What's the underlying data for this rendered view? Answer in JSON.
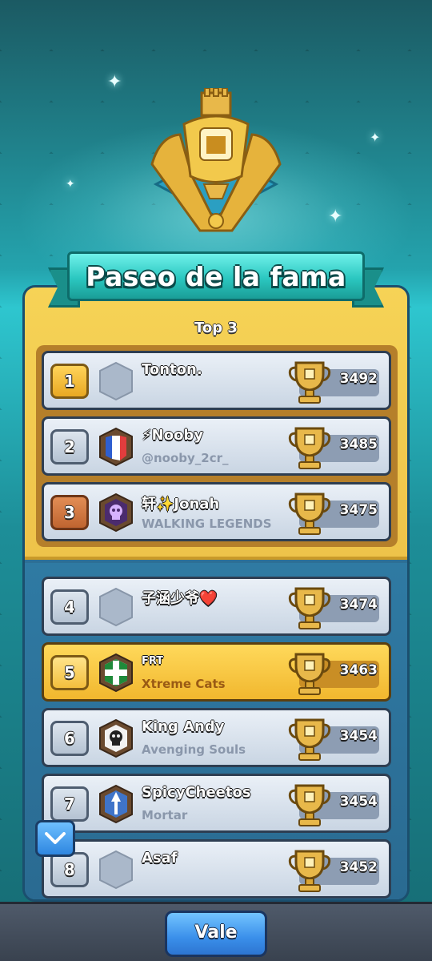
{
  "screen": {
    "title": "Paseo de la fama"
  },
  "top_section": {
    "label": "Top 3"
  },
  "players": [
    {
      "rank": "1",
      "name": "Tonton.",
      "clan": "",
      "trophies": "3492",
      "rank_style": "gold",
      "badge": "empty-badge"
    },
    {
      "rank": "2",
      "name": "⚡Nooby",
      "clan": "@nooby_2cr_",
      "trophies": "3485",
      "rank_style": "silver",
      "badge": "france-flag-badge"
    },
    {
      "rank": "3",
      "name": "轩✨Jonah",
      "clan": "WALKING LEGENDS",
      "trophies": "3475",
      "rank_style": "bronze",
      "badge": "skull-purple-badge"
    },
    {
      "rank": "4",
      "name": "子涵少爷❤️",
      "clan": "",
      "trophies": "3474",
      "rank_style": "silver",
      "badge": "empty-badge"
    },
    {
      "rank": "5",
      "name": "FRT",
      "clan": "Xtreme Cats",
      "trophies": "3463",
      "rank_style": "me",
      "badge": "green-cross-badge"
    },
    {
      "rank": "6",
      "name": "King Andy",
      "clan": "Avenging Souls",
      "trophies": "3454",
      "rank_style": "silver",
      "badge": "skull-badge"
    },
    {
      "rank": "7",
      "name": "SpicyCheetos",
      "clan": "Mortar",
      "trophies": "3454",
      "rank_style": "silver",
      "badge": "arrow-blue-badge"
    },
    {
      "rank": "8",
      "name": "Asaf",
      "clan": "",
      "trophies": "3452",
      "rank_style": "silver",
      "badge": "empty-badge"
    }
  ],
  "footer": {
    "ok_label": "Vale"
  },
  "colors": {
    "gold": "#f6d356",
    "blue_button": "#3a8fea",
    "teal": "#2bc7c0"
  }
}
